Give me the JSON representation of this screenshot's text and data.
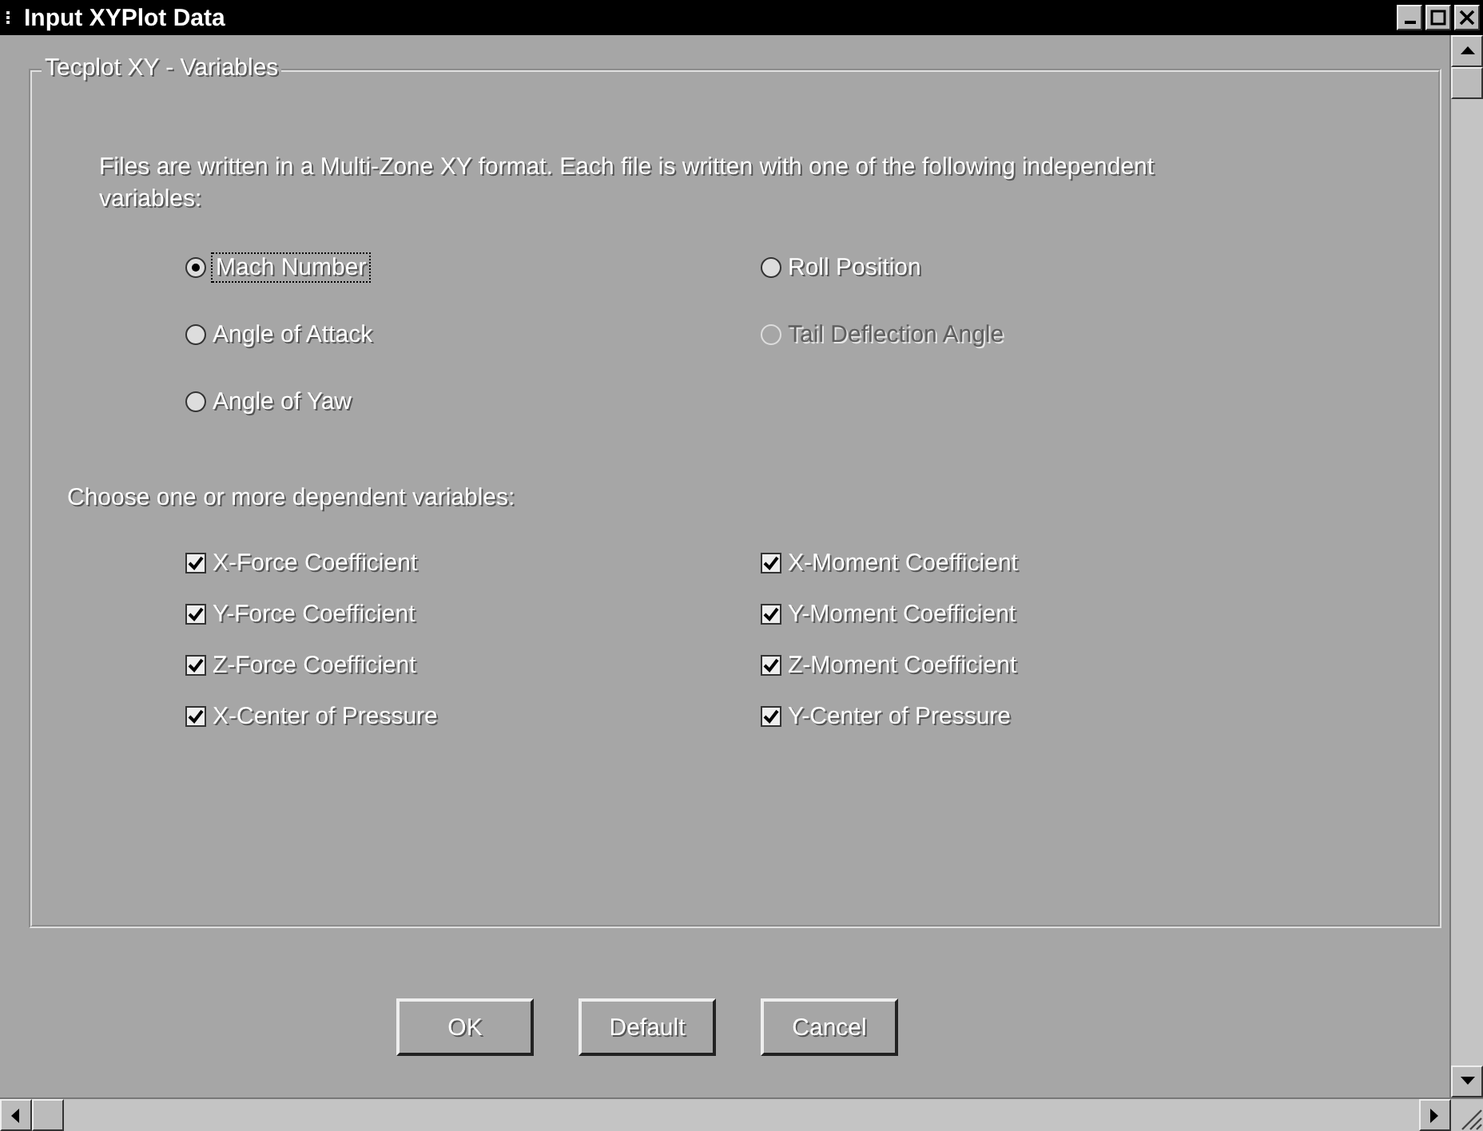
{
  "window": {
    "title": "Input XYPlot Data"
  },
  "group": {
    "title": "Tecplot XY - Variables",
    "intro": "Files are written in a Multi-Zone XY format. Each file is written with one of the following independent variables:",
    "independent": [
      {
        "label": "Mach Number",
        "selected": true,
        "disabled": false,
        "focused": true
      },
      {
        "label": "Roll Position",
        "selected": false,
        "disabled": false,
        "focused": false
      },
      {
        "label": "Angle of Attack",
        "selected": false,
        "disabled": false,
        "focused": false
      },
      {
        "label": "Tail Deflection Angle",
        "selected": false,
        "disabled": true,
        "focused": false
      },
      {
        "label": "Angle of Yaw",
        "selected": false,
        "disabled": false,
        "focused": false
      }
    ],
    "dependent_prompt": "Choose one or more dependent variables:",
    "dependent": [
      {
        "label": "X-Force Coefficient",
        "checked": true
      },
      {
        "label": "X-Moment Coefficient",
        "checked": true
      },
      {
        "label": "Y-Force Coefficient",
        "checked": true
      },
      {
        "label": "Y-Moment Coefficient",
        "checked": true
      },
      {
        "label": "Z-Force Coefficient",
        "checked": true
      },
      {
        "label": "Z-Moment Coefficient",
        "checked": true
      },
      {
        "label": "X-Center of Pressure",
        "checked": true
      },
      {
        "label": "Y-Center of Pressure",
        "checked": true
      }
    ]
  },
  "buttons": [
    "OK",
    "Default",
    "Cancel"
  ]
}
